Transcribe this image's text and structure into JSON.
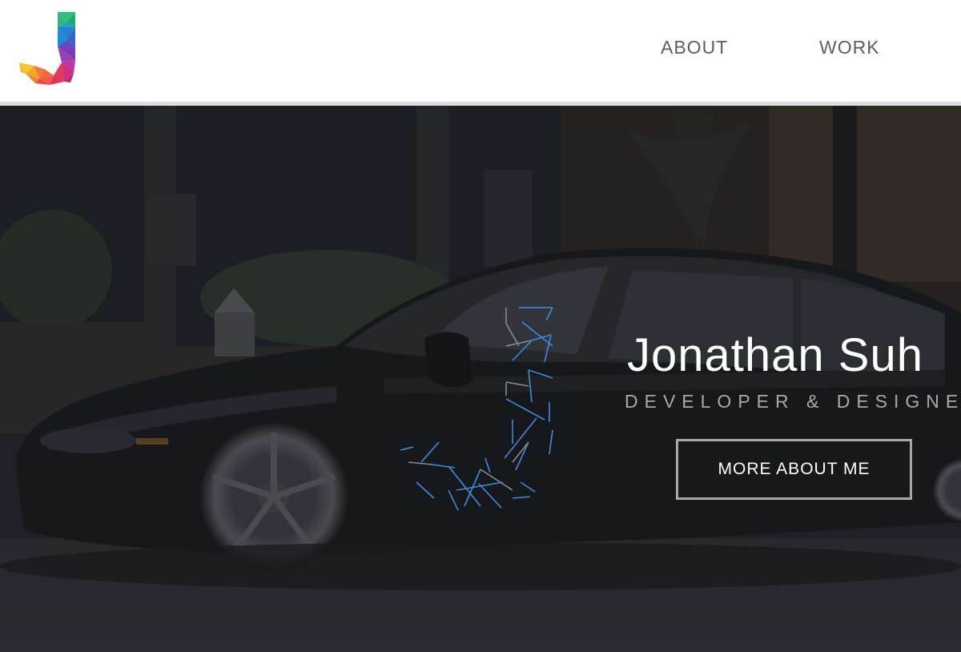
{
  "header": {
    "logo_letter": "J",
    "nav": {
      "about_label": "ABOUT",
      "work_label": "WORK"
    }
  },
  "hero": {
    "title": "Jonathan Suh",
    "subtitle": "DEVELOPER & DESIGNER",
    "cta_label": "MORE ABOUT ME",
    "background": "dark photo of a black sports car parked in front of a building with hedges",
    "overlay_icon": "constellation-j-icon"
  },
  "colors": {
    "header_bg": "#ffffff",
    "nav_text": "#5d5e63",
    "hero_overlay": "#24262a",
    "title_text": "#ffffff",
    "subtitle_text": "#a7a8ab",
    "button_border": "#a8a9ac",
    "constellation_blue": "#3a8ee0"
  }
}
